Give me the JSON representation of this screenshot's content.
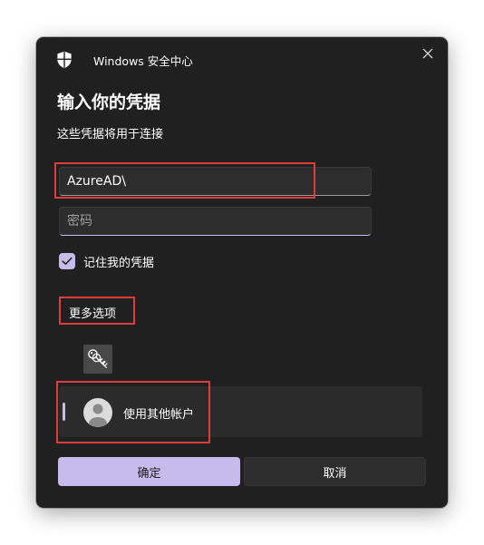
{
  "window": {
    "app_title": "Windows 安全中心",
    "heading": "输入你的凭据",
    "subheading": "这些凭据将用于连接"
  },
  "username_field": {
    "value": "AzureAD\\"
  },
  "password_field": {
    "placeholder": "密码",
    "value": ""
  },
  "remember": {
    "label": "记住我的凭据",
    "checked": true
  },
  "more_options": {
    "label": "更多选项"
  },
  "other_account": {
    "label": "使用其他帐户"
  },
  "actions": {
    "ok_label": "确定",
    "cancel_label": "取消"
  },
  "icons": {
    "app": "shield-icon",
    "close": "close-icon",
    "check": "checkmark-icon",
    "key": "key-icon",
    "avatar": "person-avatar-icon"
  },
  "colors": {
    "dialog_bg": "#202020",
    "accent": "#c5bcec",
    "input_bg": "#2d2d2d",
    "card_bg": "#2b2b2b",
    "annotation_red": "#e03c3c"
  }
}
